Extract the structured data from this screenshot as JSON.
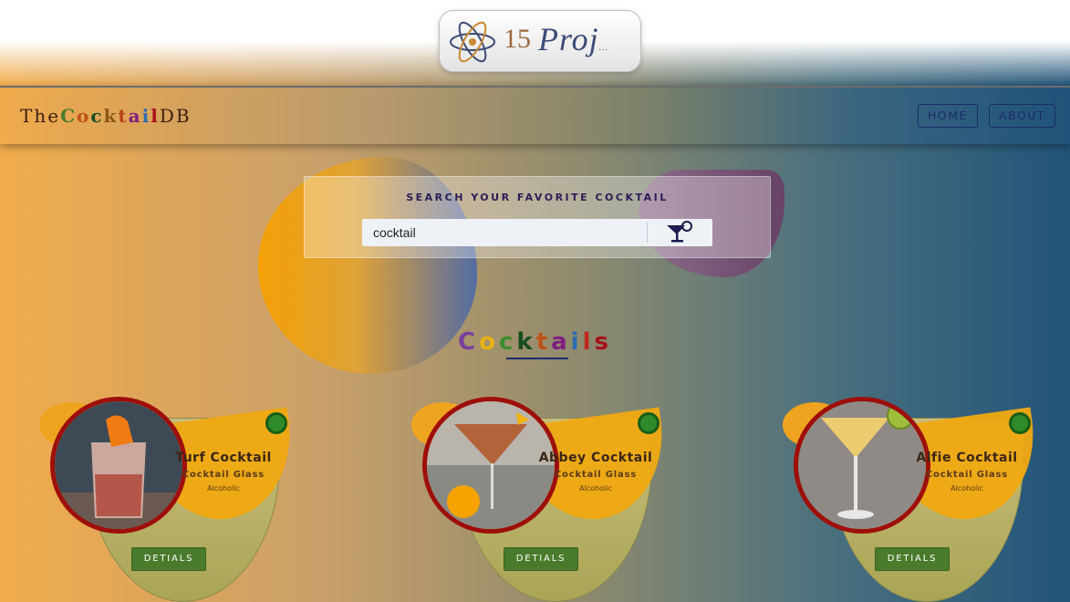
{
  "logo": {
    "number": "15",
    "word": "Proj",
    "suffix": "..."
  },
  "navbar": {
    "brand_pre": "The",
    "brand_letters": [
      "C",
      "o",
      "c",
      "k",
      "t",
      "a",
      "i",
      "l"
    ],
    "brand_post": "DB",
    "home_label": "HOME",
    "about_label": "ABOUT"
  },
  "search": {
    "title": "Search your favorite cocktail",
    "value": "cocktail",
    "button_icon": "cocktail-glass-icon"
  },
  "section": {
    "title_letters": [
      "C",
      "o",
      "c",
      "k",
      "t",
      "a",
      "i",
      "l",
      "s"
    ],
    "letter_colors": [
      "#7a3f9b",
      "#e7b313",
      "#3c8d2f",
      "#1a4b21",
      "#c0531a",
      "#7e1e80",
      "#2b6cb2",
      "#c0281e",
      "#a6121a"
    ]
  },
  "cocktails": [
    {
      "name": "Turf Cocktail",
      "glass": "Cocktail Glass",
      "type": "Alcoholic",
      "button": "DETIALS",
      "image": "turf-cocktail-photo"
    },
    {
      "name": "Abbey Cocktail",
      "glass": "Cocktail Glass",
      "type": "Alcoholic",
      "button": "DETIALS",
      "image": "abbey-cocktail-photo"
    },
    {
      "name": "Alfie Cocktail",
      "glass": "Cocktail Glass",
      "type": "Alcoholic",
      "button": "DETIALS",
      "image": "alfie-cocktail-photo"
    }
  ],
  "colors": {
    "accent_navy": "#1c2b6c",
    "button_green": "#4a7a2c",
    "ring_red": "#9e0f0a"
  }
}
